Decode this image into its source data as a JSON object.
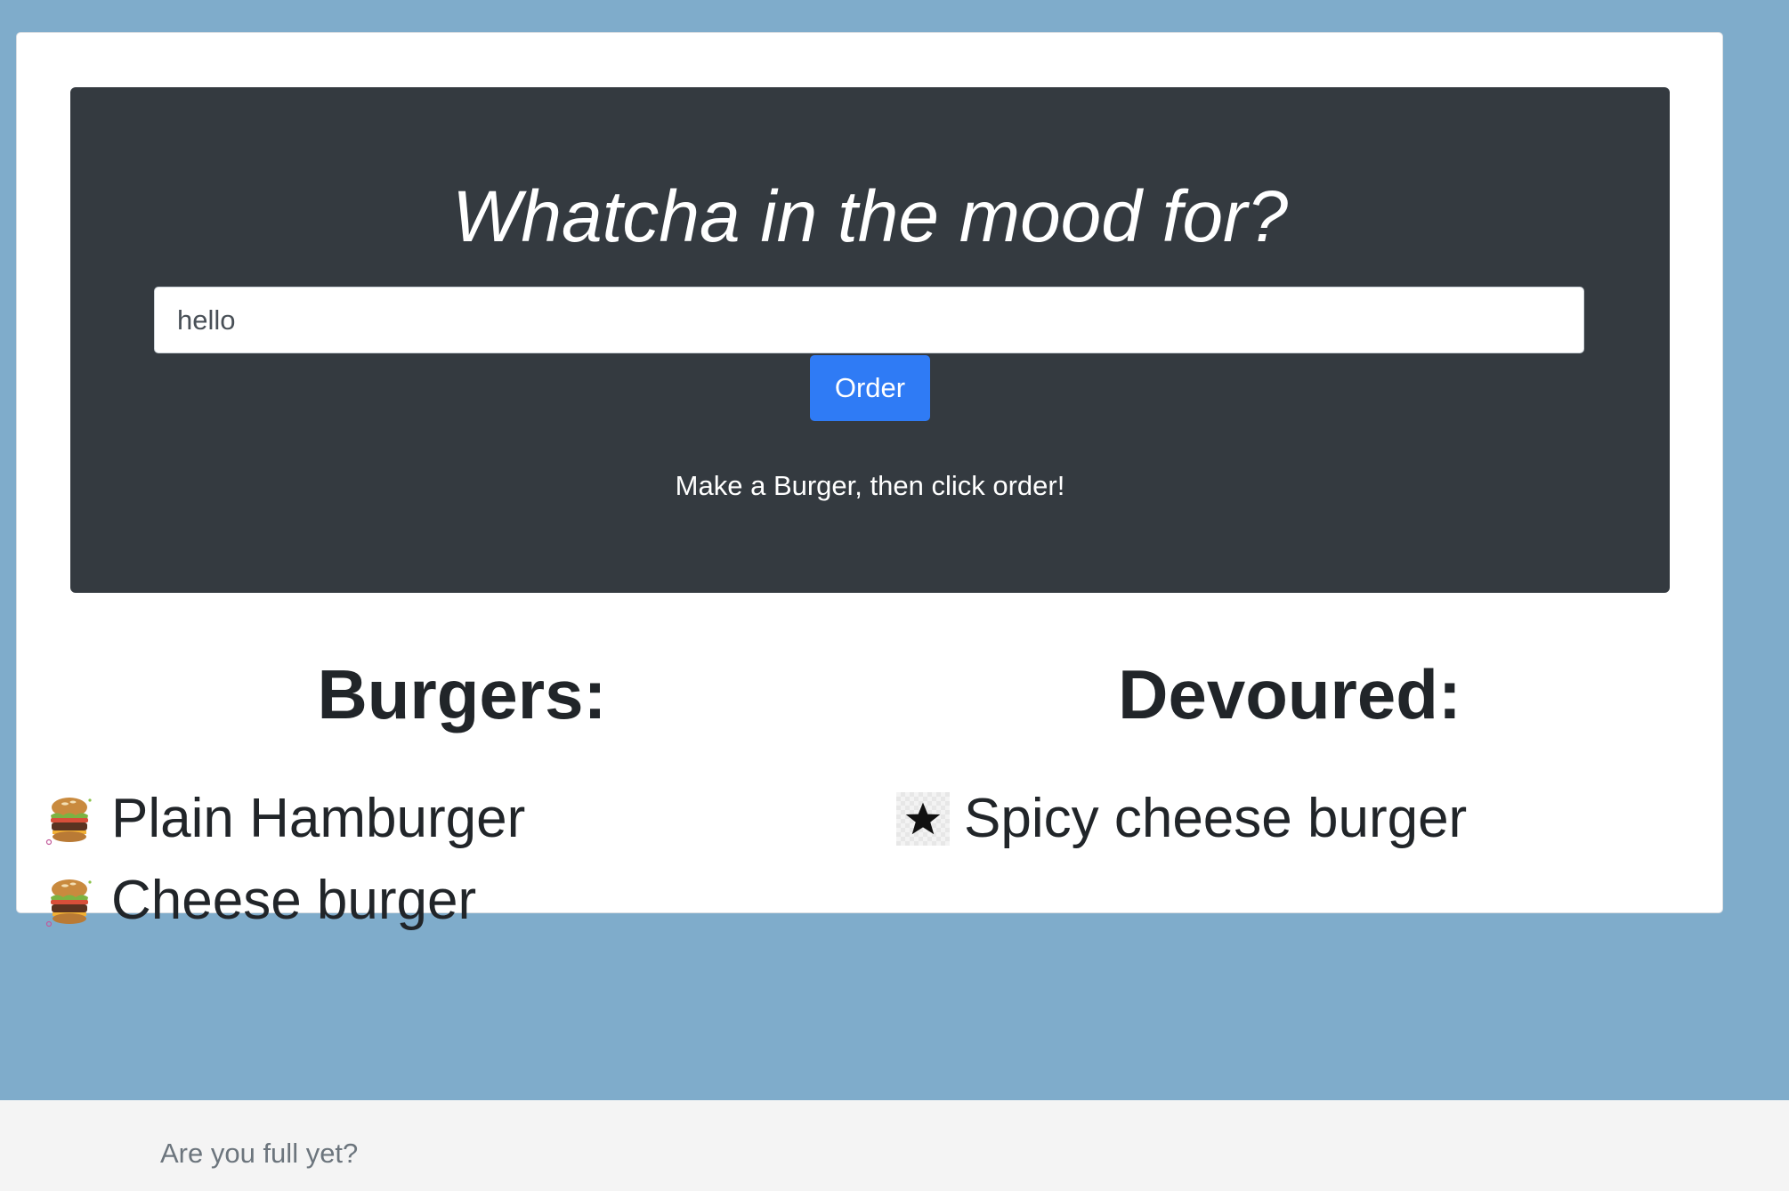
{
  "hero": {
    "title": "Whatcha in the mood for?",
    "input_value": "hello",
    "order_label": "Order",
    "hint": "Make a Burger, then click order!"
  },
  "burgers": {
    "heading": "Burgers:",
    "items": [
      {
        "name": "Plain Hamburger",
        "icon": "burger-icon"
      },
      {
        "name": "Cheese burger",
        "icon": "burger-icon"
      }
    ]
  },
  "devoured": {
    "heading": "Devoured:",
    "items": [
      {
        "name": "Spicy cheese burger",
        "icon": "star-icon"
      }
    ]
  },
  "footer": {
    "text": "Are you full yet?"
  },
  "colors": {
    "page_background": "#7faccb",
    "hero_background": "#343a40",
    "button": "#2f7bf5",
    "footer_background": "#f4f4f4"
  }
}
